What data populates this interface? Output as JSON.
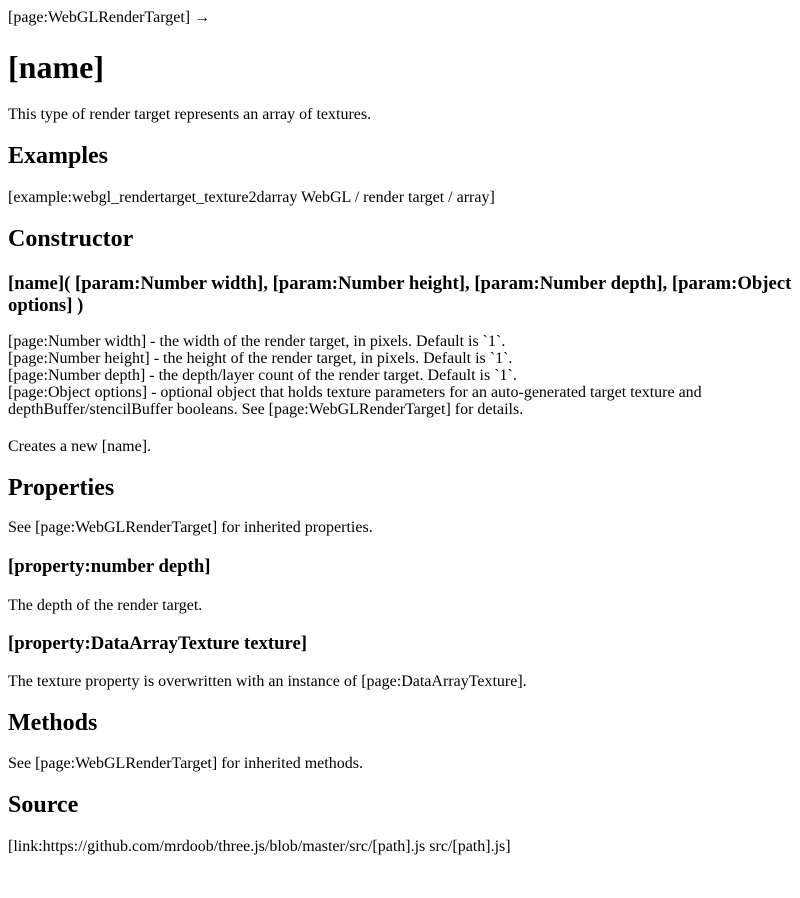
{
  "breadcrumb": "[page:WebGLRenderTarget] →",
  "title": "[name]",
  "intro": "This type of render target represents an array of textures.",
  "examples": {
    "heading": "Examples",
    "link": "[example:webgl_rendertarget_texture2darray WebGL / render target / array]"
  },
  "constructor": {
    "heading": "Constructor",
    "signature": "[name]( [param:Number width], [param:Number height], [param:Number depth], [param:Object options] )",
    "params": [
      "[page:Number width] - the width of the render target, in pixels. Default is `1`.",
      "[page:Number height] - the height of the render target, in pixels. Default is `1`.",
      "[page:Number depth] - the depth/layer count of the render target. Default is `1`.",
      "[page:Object options] - optional object that holds texture parameters for an auto-generated target texture and depthBuffer/stencilBuffer booleans. See [page:WebGLRenderTarget] for details."
    ],
    "creates": "Creates a new [name]."
  },
  "properties": {
    "heading": "Properties",
    "inherited": "See [page:WebGLRenderTarget] for inherited properties.",
    "items": [
      {
        "name": "[property:number depth]",
        "description": "The depth of the render target."
      },
      {
        "name": "[property:DataArrayTexture texture]",
        "description": "The texture property is overwritten with an instance of [page:DataArrayTexture]."
      }
    ]
  },
  "methods": {
    "heading": "Methods",
    "inherited": "See [page:WebGLRenderTarget] for inherited methods."
  },
  "source": {
    "heading": "Source",
    "link": "[link:https://github.com/mrdoob/three.js/blob/master/src/[path].js src/[path].js]"
  }
}
